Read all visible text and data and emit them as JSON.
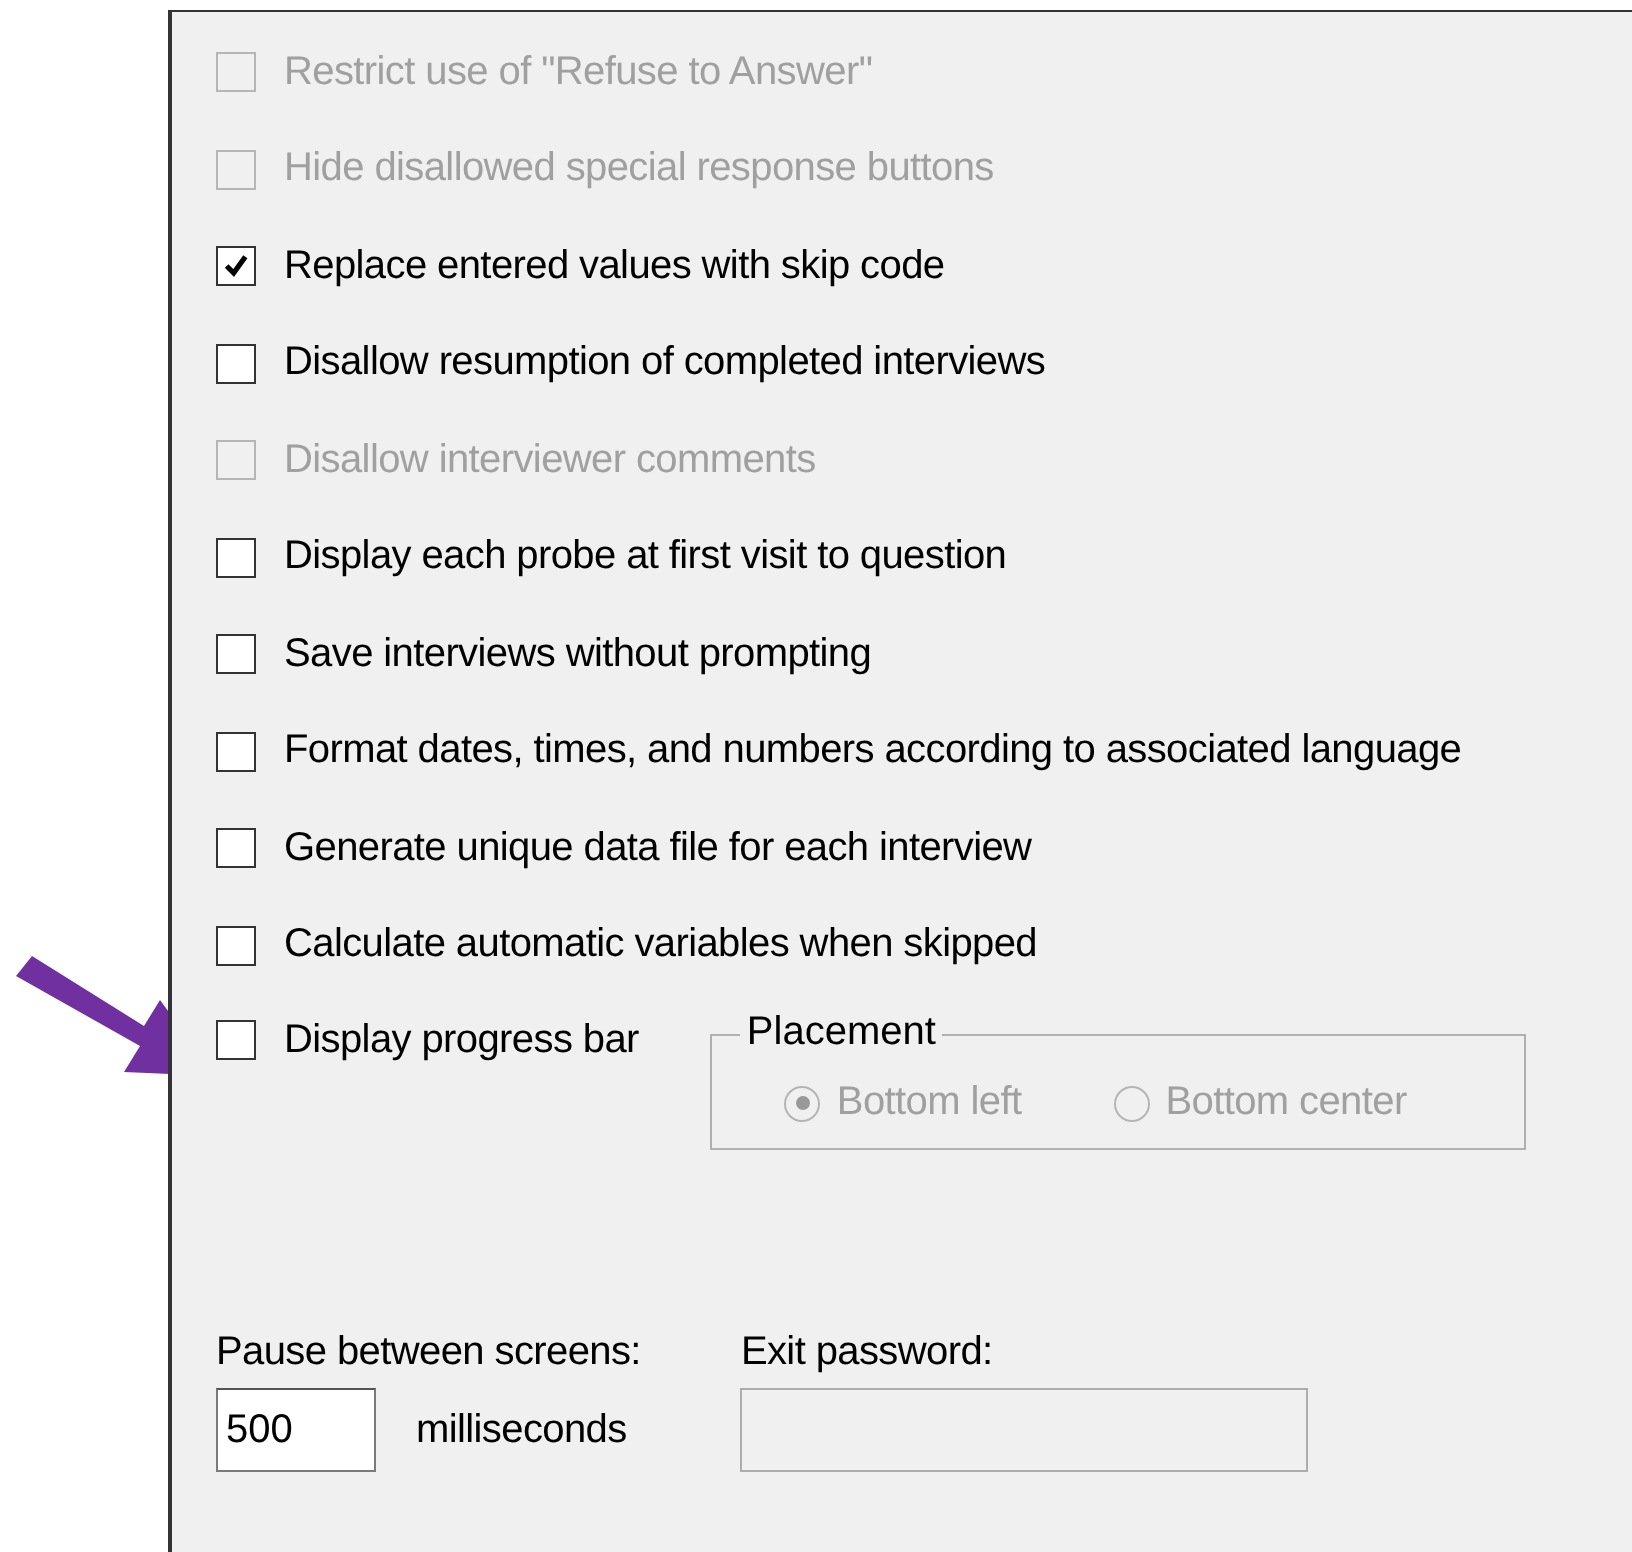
{
  "options": [
    {
      "label": "Restrict use of \"Refuse to Answer\"",
      "checked": false,
      "disabled": true
    },
    {
      "label": "Hide disallowed special response buttons",
      "checked": false,
      "disabled": true
    },
    {
      "label": "Replace entered values with skip code",
      "checked": true,
      "disabled": false
    },
    {
      "label": "Disallow resumption of completed interviews",
      "checked": false,
      "disabled": false
    },
    {
      "label": "Disallow interviewer comments",
      "checked": false,
      "disabled": true
    },
    {
      "label": "Display each probe at first visit to question",
      "checked": false,
      "disabled": false
    },
    {
      "label": "Save interviews without prompting",
      "checked": false,
      "disabled": false
    },
    {
      "label": "Format dates, times, and numbers according to associated language",
      "checked": false,
      "disabled": false
    },
    {
      "label": "Generate unique data file for each interview",
      "checked": false,
      "disabled": false
    },
    {
      "label": "Calculate automatic variables when skipped",
      "checked": false,
      "disabled": false
    }
  ],
  "progress": {
    "label": "Display progress bar",
    "checked": false,
    "placement": {
      "title": "Placement",
      "disabled": true,
      "options": [
        {
          "label": "Bottom left",
          "selected": true
        },
        {
          "label": "Bottom center",
          "selected": false
        }
      ]
    }
  },
  "pause": {
    "label": "Pause between screens:",
    "value": "500",
    "unit": "milliseconds"
  },
  "exit_password": {
    "label": "Exit password:",
    "disabled": true
  }
}
